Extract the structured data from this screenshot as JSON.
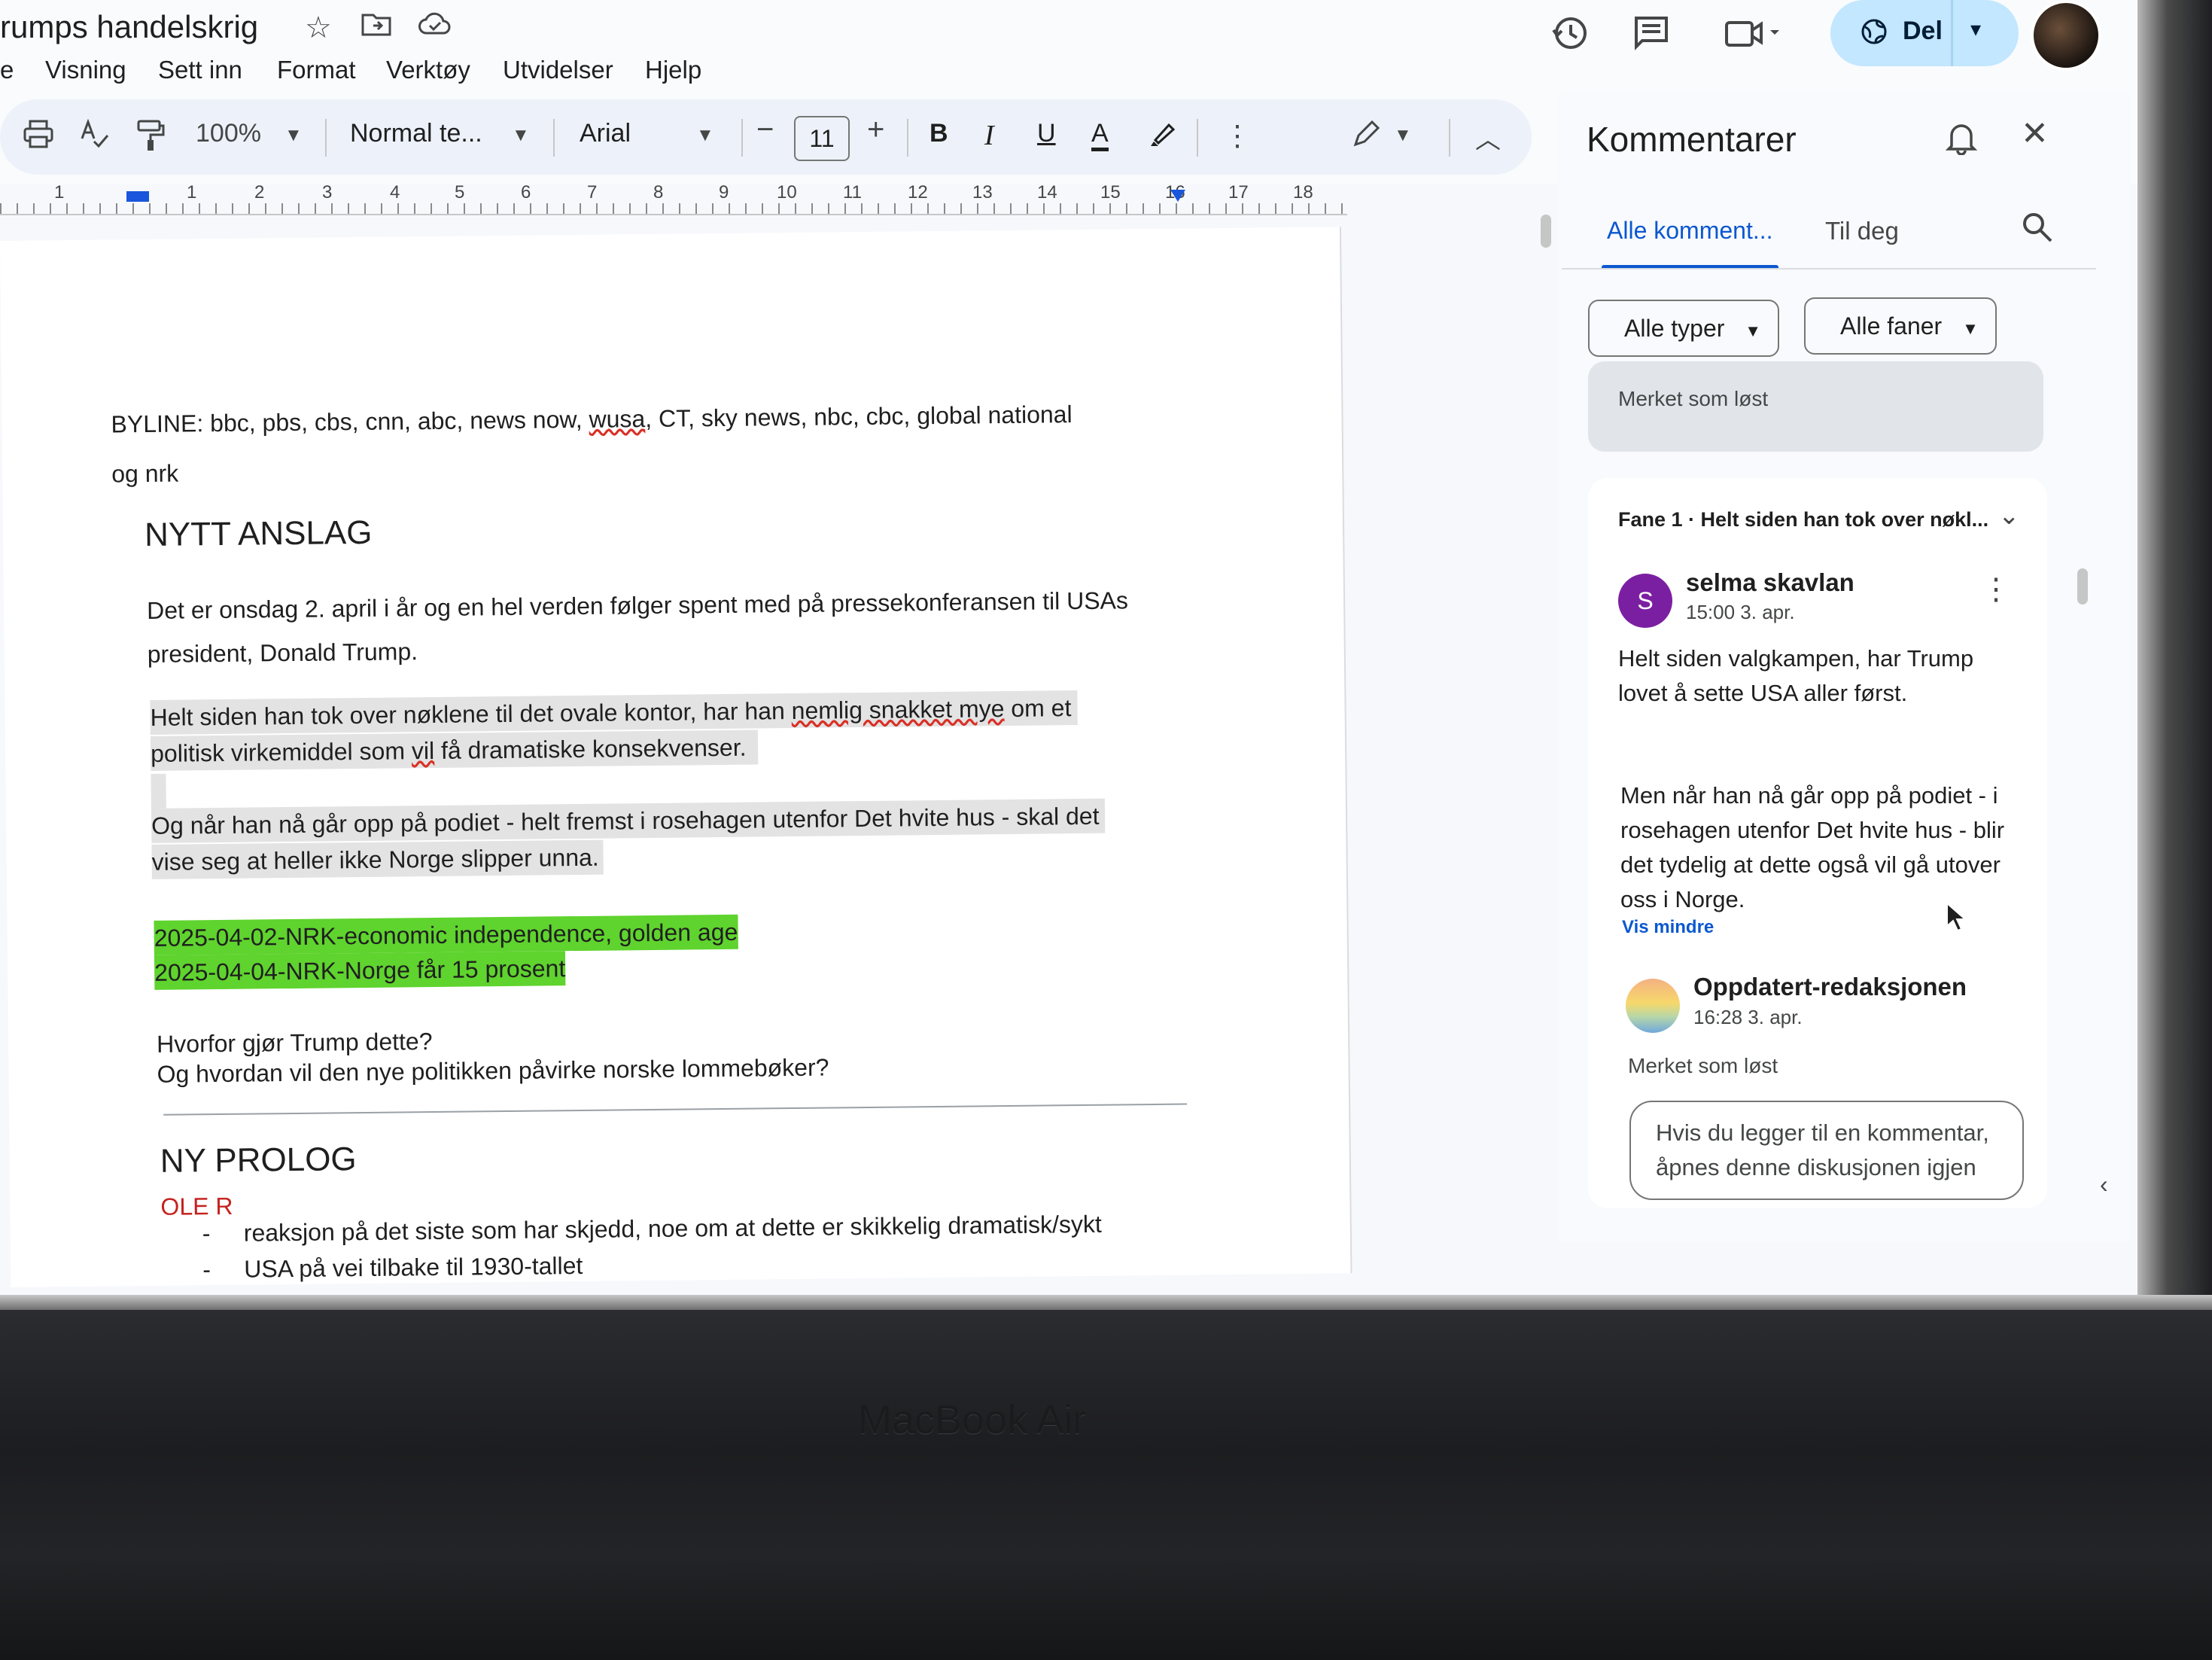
{
  "header": {
    "doc_title": "rumps handelskrig",
    "menu": [
      "e",
      "Visning",
      "Sett inn",
      "Format",
      "Verktøy",
      "Utvidelser",
      "Hjelp"
    ],
    "share_label": "Del"
  },
  "toolbar": {
    "zoom": "100%",
    "style": "Normal te...",
    "font": "Arial",
    "font_size": "11",
    "minus": "−",
    "plus": "+",
    "bold": "B",
    "italic": "I",
    "underline": "U",
    "text_color": "A"
  },
  "ruler": {
    "numbers": [
      "1",
      "1",
      "2",
      "3",
      "4",
      "5",
      "6",
      "7",
      "8",
      "9",
      "10",
      "11",
      "12",
      "13",
      "14",
      "15",
      "16",
      "17",
      "18"
    ]
  },
  "document": {
    "byline_1": "BYLINE: bbc, pbs, cbs, cnn, abc, news now,",
    "byline_wavy": "wusa",
    "byline_2": ", CT, sky news, nbc, cbc, global national",
    "byline_3": "og nrk",
    "heading_1": "NYTT ANSLAG",
    "para_1a": "Det er onsdag 2. april i år og en hel verden følger spent med på pressekonferansen til USAs",
    "para_1b": "president, Donald Trump.",
    "para_2a_pre": "Helt siden han tok over nøklene til det ovale kontor, har han ",
    "para_2a_wavy": "nemlig snakket mye",
    "para_2a_post": " om et",
    "para_2b_pre": "politisk virkemiddel som ",
    "para_2b_wavy": "vil",
    "para_2b_post": " få dramatiske konsekvenser.",
    "para_3a": "Og når han nå går opp på podiet - helt fremst i rosehagen utenfor Det hvite hus - skal det",
    "para_3b": "vise seg at heller ikke Norge slipper unna.",
    "highlight_1": "2025-04-02-NRK-economic independence, golden age",
    "highlight_2": "2025-04-04-NRK-Norge får 15 prosent",
    "question_1": "Hvorfor gjør Trump dette?",
    "question_2": "Og hvordan vil den nye politikken påvirke norske lommebøker?",
    "heading_2": "NY PROLOG",
    "prolog_author": "OLE R",
    "bullet_1": "reaksjon på det siste som har skjedd, noe om at dette er skikkelig dramatisk/sykt",
    "bullet_2": "USA på vei tilbake til 1930-tallet",
    "bullet_marker": "-"
  },
  "comments": {
    "panel_title": "Kommentarer",
    "tab_all": "Alle komment...",
    "tab_you": "Til deg",
    "filter_types": "Alle typer",
    "filter_tabs": "Alle faner",
    "resolved_banner": "Merket som løst",
    "thread_tab": "Fane 1 · Helt siden han tok over nøkl...",
    "comment_1": {
      "avatar_letter": "S",
      "author": "selma skavlan",
      "time": "15:00 3. apr.",
      "body_1": "Helt siden valgkampen, har  Trump",
      "body_2": "lovet å sette USA aller først.",
      "body_3": "Men når han nå går opp på podiet - i",
      "body_4": "rosehagen utenfor Det hvite hus - blir",
      "body_5": "det tydelig at dette også vil gå utover",
      "body_6": "oss i Norge.",
      "show_less": "Vis mindre"
    },
    "comment_2": {
      "author": "Oppdatert-redaksjonen",
      "time": "16:28 3. apr.",
      "status": "Merket som løst"
    },
    "reply_1": "Hvis du legger til en kommentar,",
    "reply_2": "åpnes denne diskusjonen igjen"
  },
  "device": {
    "brand": "MacBook Air"
  },
  "colors": {
    "share_bg": "#c2e7ff",
    "accent_blue": "#0b57d0",
    "highlight_green": "#5fd32e",
    "selection_gray": "#e3e3e3",
    "avatar_purple": "#7b1fa2",
    "prolog_red": "#c5221f"
  },
  "icons": [
    "star-icon",
    "move-folder-icon",
    "cloud-icon",
    "history-icon",
    "comments-icon",
    "meet-icon",
    "globe-icon",
    "print-icon",
    "spellcheck-icon",
    "paint-format-icon",
    "highlighter-icon",
    "more-icon",
    "pencil-icon",
    "collapse-icon",
    "bell-icon",
    "close-icon",
    "search-icon",
    "chevron-down-icon",
    "more-vert-icon"
  ]
}
